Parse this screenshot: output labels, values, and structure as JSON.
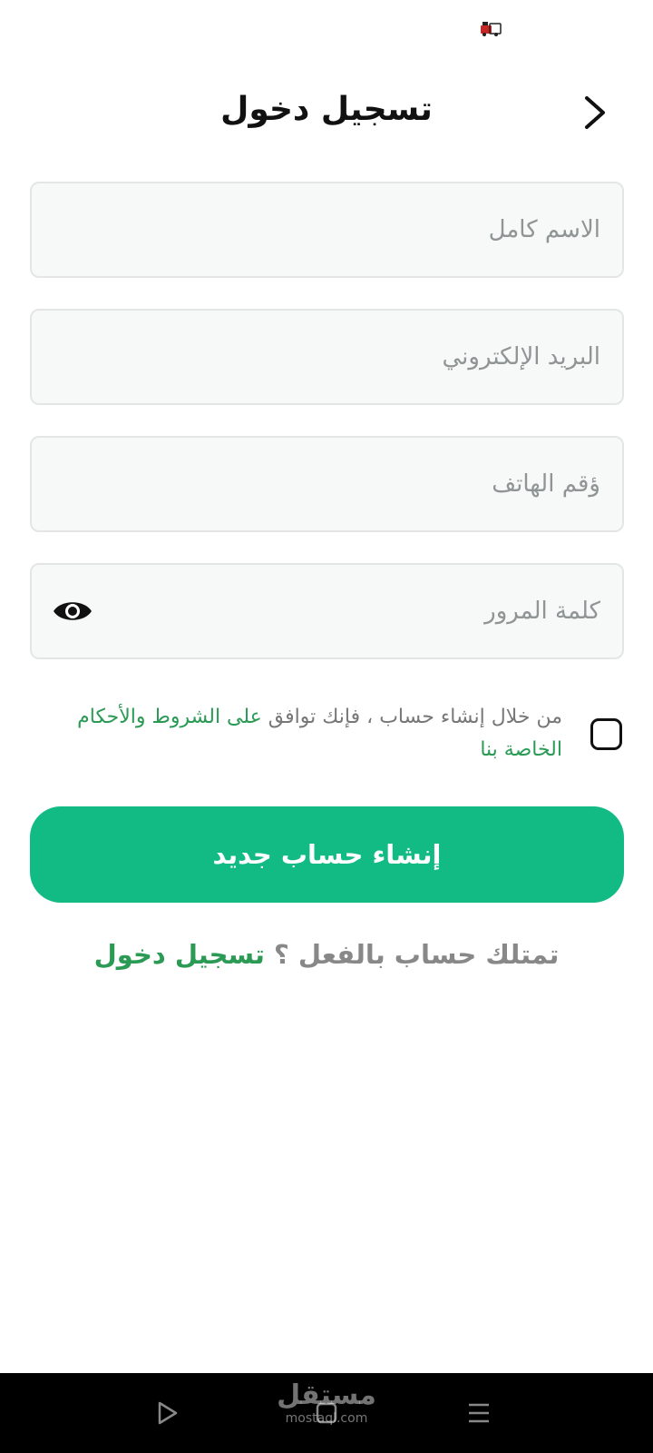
{
  "colors": {
    "accent": "#13bb84",
    "link": "#2a9a55",
    "placeholder": "#8f9595",
    "field_bg": "#f7f8f8",
    "field_border": "#e4e6e6"
  },
  "status_bar": {
    "icon": "notification-icon"
  },
  "header": {
    "title": "تسجيل دخول",
    "back_icon": "chevron-right-icon"
  },
  "form": {
    "full_name": {
      "placeholder": "الاسم كامل",
      "value": ""
    },
    "email": {
      "placeholder": "البريد الإلكتروني",
      "value": ""
    },
    "phone": {
      "placeholder": "ؤقم الهاتف",
      "value": ""
    },
    "password": {
      "placeholder": "كلمة المرور",
      "value": "",
      "toggle_icon": "eye-icon"
    }
  },
  "terms": {
    "text": "من خلال إنشاء حساب ، فإنك توافق",
    "link": "على الشروط والأحكام الخاصة بنا",
    "checked": false
  },
  "create_account_label": "إنشاء حساب جديد",
  "login_prompt": {
    "text": "تمتلك حساب بالفعل ؟",
    "link": "تسجيل دخول"
  },
  "nav_bar": {
    "buttons": [
      "play-icon",
      "home-icon",
      "menu-icon"
    ]
  },
  "watermark": {
    "arabic": "مستقل",
    "latin": "mostaql.com"
  }
}
